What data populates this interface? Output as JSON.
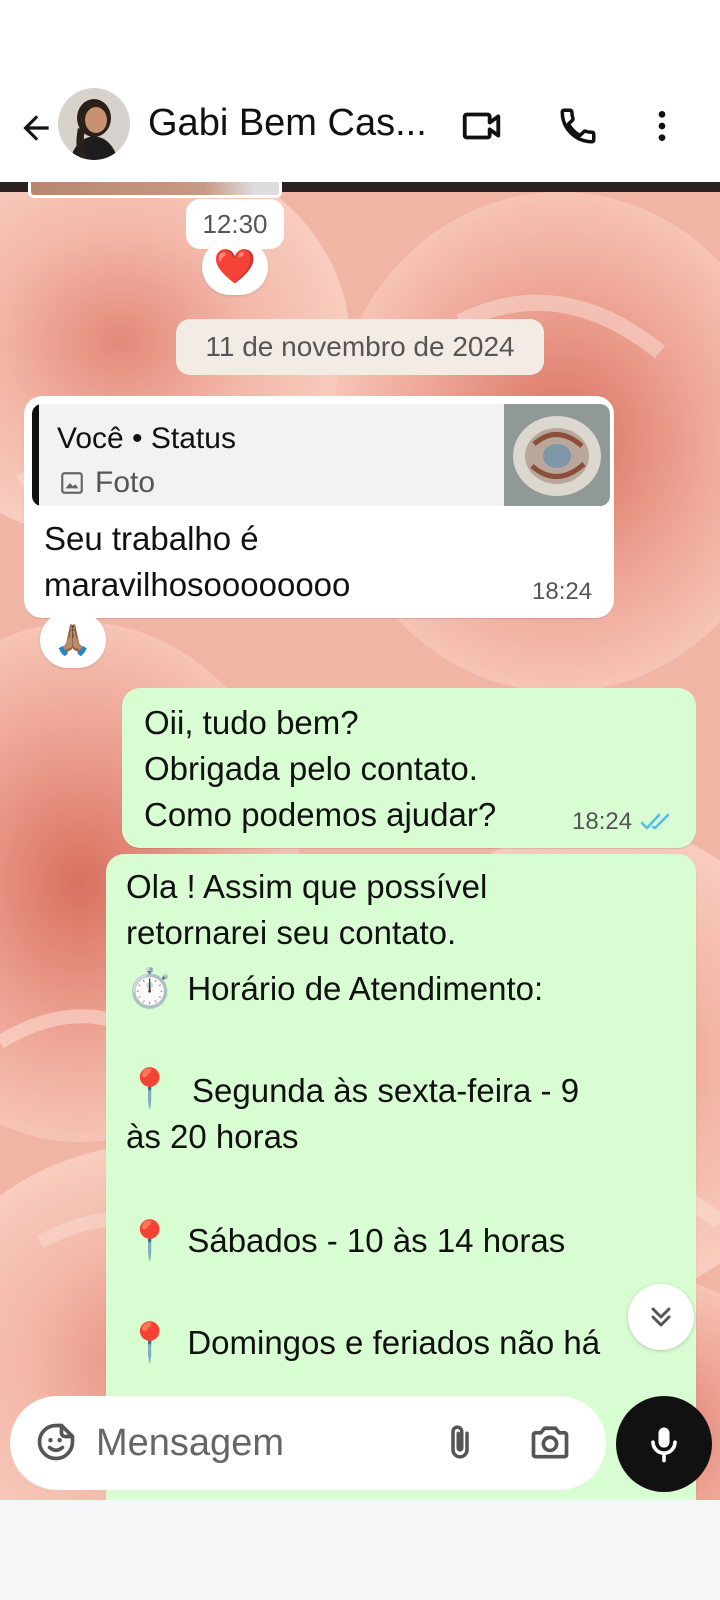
{
  "header": {
    "contact_name": "Gabi Bem Cas...",
    "icons": [
      "back-arrow-icon",
      "video-call-icon",
      "phone-icon",
      "more-options-icon"
    ]
  },
  "chat": {
    "earlier_time": "12:30",
    "earlier_reaction": "❤️",
    "date_divider": "11 de novembro de 2024",
    "messages": [
      {
        "direction": "incoming",
        "quote_title": "Você • Status",
        "quote_subtitle": "Foto",
        "text": "Seu trabalho é\nmaravilhosoooooooo",
        "time": "18:24",
        "reaction": "🙏🏽"
      },
      {
        "direction": "outgoing",
        "text": "Oii, tudo bem?\nObrigada pelo contato.\nComo podemos ajudar?",
        "time": "18:24",
        "status": "read"
      },
      {
        "direction": "outgoing",
        "line1": "Ola ! Assim que possível\nretornarei seu contato.",
        "hours_title": "Horário de Atendimento:",
        "hours_emoji": "⏱️",
        "pin_emoji": "📍",
        "weekdays": "Segunda às sexta-feira - 9\nàs 20 horas",
        "saturday": "Sábados - 10 às 14 horas",
        "sunday": "Domingos e feriados não há"
      }
    ]
  },
  "composer": {
    "placeholder": "Mensagem",
    "icons": [
      "sticker-icon",
      "attach-icon",
      "camera-icon",
      "mic-icon"
    ]
  },
  "colors": {
    "outgoing_bubble": "#d9fdd3",
    "incoming_bubble": "#ffffff",
    "read_tick": "#53bdeb",
    "wallpaper_base": "#f0b4a6"
  }
}
